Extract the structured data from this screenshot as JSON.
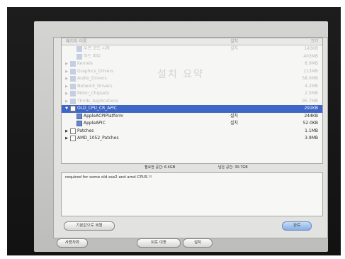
{
  "list": {
    "columns": [
      "패키지 이름",
      "설치",
      "크기"
    ],
    "rows": [
      {
        "label": "우프 코드 시저",
        "action": "설치",
        "size": "143KB",
        "faded": true,
        "expander": "",
        "icon": "pkg",
        "indent": 1
      },
      {
        "label": "하드 파티",
        "action": "",
        "size": "403MB",
        "faded": true,
        "expander": "",
        "icon": "pkg",
        "indent": 1
      },
      {
        "label": "Kernels",
        "action": "",
        "size": "8.9MB",
        "faded": true,
        "expander": "▶",
        "icon": "pkg",
        "indent": 0
      },
      {
        "label": "Graphics_Drivers",
        "action": "",
        "size": "113MB",
        "faded": true,
        "expander": "▶",
        "icon": "pkg",
        "indent": 0
      },
      {
        "label": "Audio_Drivers",
        "action": "",
        "size": "58.0MB",
        "faded": true,
        "expander": "▶",
        "icon": "pkg",
        "indent": 0
      },
      {
        "label": "Network_Drivers",
        "action": "",
        "size": "4.2MB",
        "faded": true,
        "expander": "▶",
        "icon": "pkg",
        "indent": 0
      },
      {
        "label": "Mobo_Chipsets",
        "action": "",
        "size": "2.5MB",
        "faded": true,
        "expander": "▶",
        "icon": "pkg",
        "indent": 0
      },
      {
        "label": "Thirds_Applications",
        "action": "",
        "size": "95.7MB",
        "faded": true,
        "expander": "▶",
        "icon": "pkg",
        "indent": 0
      },
      {
        "label": "OLD_CPU_CR_APIC",
        "action": "",
        "size": "291KB",
        "faded": false,
        "selected": true,
        "expander": "▼",
        "icon": "box",
        "indent": 0
      },
      {
        "label": "AppleACPIPlatform",
        "action": "설치",
        "size": "244KB",
        "faded": false,
        "expander": "",
        "icon": "pkg",
        "indent": 1
      },
      {
        "label": "AppleAPIC",
        "action": "설치",
        "size": "52.0KB",
        "faded": false,
        "expander": "",
        "icon": "pkg",
        "indent": 1
      },
      {
        "label": "Patches",
        "action": "",
        "size": "1.1MB",
        "faded": false,
        "expander": "▶",
        "icon": "box",
        "indent": 0
      },
      {
        "label": "AMD_1052_Patches",
        "action": "",
        "size": "3.9MB",
        "faded": false,
        "expander": "▶",
        "icon": "box",
        "indent": 0
      }
    ]
  },
  "watermark": "설치 요약",
  "space": {
    "required": "필요한 공간: 6.4GB",
    "remaining": "남은 공간: 30.7GB"
  },
  "description": "required for some old sse2 and amd CPUS !!",
  "buttons": {
    "restore_defaults": "기본값으로 복원",
    "done": "완료",
    "customize": "사용자화",
    "go_back": "뒤로 이동",
    "install": "설치"
  }
}
